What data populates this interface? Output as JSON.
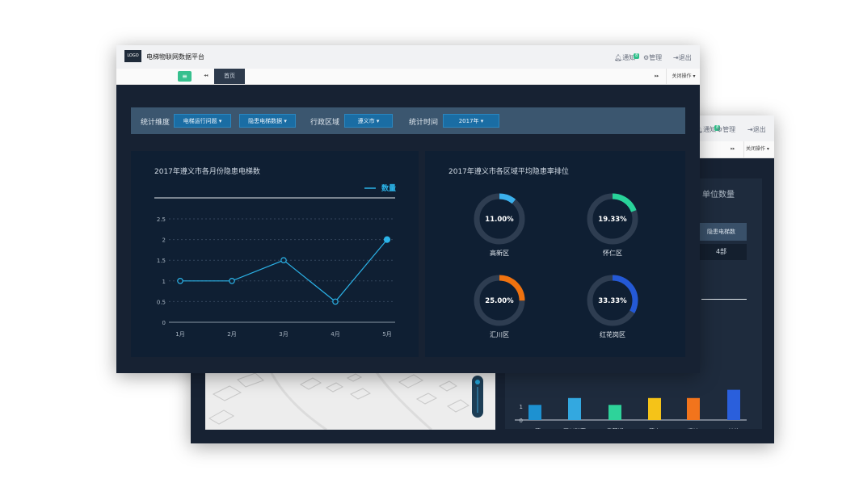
{
  "back_window": {
    "header": {
      "notify_label": "通知",
      "notify_badge": "8",
      "manage_label": "管理",
      "logout_label": "退出"
    },
    "nav": {
      "close_ops": "关闭操作"
    },
    "panel": {
      "title": "单位数量",
      "column_header": "隐患电梯数",
      "column_value": "4部",
      "chart_data": {
        "type": "bar",
        "categories": [
          "三菱",
          "四川科莱",
          "奥莱斯",
          "蒂森",
          "迅达",
          "其他"
        ],
        "values": [
          1.1,
          1.6,
          1.1,
          1.6,
          1.6,
          2.2
        ],
        "yticks": [
          "1",
          "0"
        ],
        "colors": [
          "#1d91d1",
          "#33a8e0",
          "#2ed39a",
          "#f5c318",
          "#f2741c",
          "#2a5fdc"
        ]
      }
    }
  },
  "front_window": {
    "header": {
      "logo": "LOGO",
      "title": "电梯物联网数据平台",
      "notify_label": "通知",
      "notify_badge": "8",
      "manage_label": "管理",
      "logout_label": "退出"
    },
    "nav": {
      "home_tab": "首页",
      "close_ops": "关闭操作"
    },
    "filters": [
      {
        "label": "统计维度",
        "options": [
          "电梯运行问题",
          "隐患电梯数据"
        ]
      },
      {
        "label": "行政区域",
        "options": [
          "遵义市"
        ]
      },
      {
        "label": "统计时间",
        "options": [
          "2017年"
        ]
      }
    ],
    "line_card": {
      "title": "2017年遵义市各月份隐患电梯数",
      "chart_data": {
        "type": "line",
        "x": [
          "1月",
          "2月",
          "3月",
          "4月",
          "5月"
        ],
        "series": [
          {
            "name": "数量",
            "values": [
              1,
              1,
              1.5,
              0.5,
              2
            ]
          }
        ],
        "yticks": [
          "2.5",
          "2",
          "1.5",
          "1",
          "0.5",
          "0"
        ],
        "ylim": [
          0,
          2.5
        ],
        "color": "#2bb3e8"
      }
    },
    "donut_card": {
      "title": "2017年遵义市各区域平均隐患率排位",
      "chart_data": {
        "type": "pie",
        "items": [
          {
            "label": "高新区",
            "value": 11.0,
            "display": "11.00%",
            "color": "#3bb0ec"
          },
          {
            "label": "怀仁区",
            "value": 19.33,
            "display": "19.33%",
            "color": "#28d39a"
          },
          {
            "label": "汇川区",
            "value": 25.0,
            "display": "25.00%",
            "color": "#f0720f"
          },
          {
            "label": "红花岗区",
            "value": 33.33,
            "display": "33.33%",
            "color": "#2459d6"
          }
        ]
      }
    }
  }
}
